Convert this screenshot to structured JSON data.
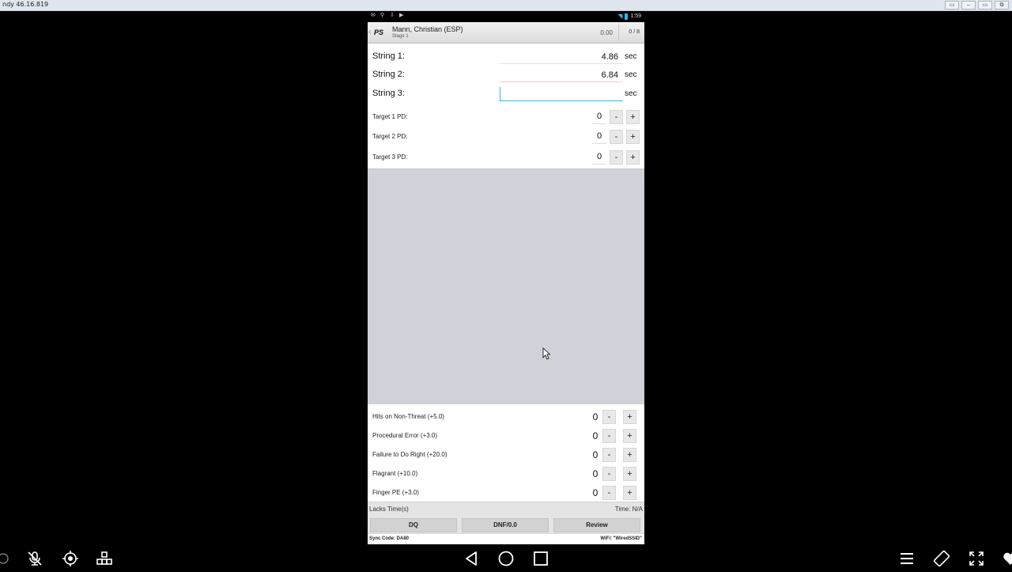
{
  "window": {
    "title": "ndy 46.16.819",
    "buttons": [
      "▭",
      "–",
      "▭",
      "⧉"
    ]
  },
  "statusbar": {
    "time": "1:59",
    "left_icons": [
      "mail-icon",
      "usb-icon",
      "download-icon",
      "play-icon"
    ]
  },
  "appbar": {
    "logo": "PS",
    "competitor": "Mann, Christian (ESP)",
    "stage": "Stage 1",
    "score": "0.00",
    "menu": "0 / 8"
  },
  "strings": [
    {
      "label": "String 1:",
      "value": "4.86",
      "unit": "sec"
    },
    {
      "label": "String 2:",
      "value": "6.84",
      "unit": "sec"
    },
    {
      "label": "String 3:",
      "value": "",
      "unit": "sec"
    }
  ],
  "targets": [
    {
      "label": "Target 1 PD:",
      "value": "0",
      "minus": "-",
      "plus": "+"
    },
    {
      "label": "Target 2 PD:",
      "value": "0",
      "minus": "-",
      "plus": "+"
    },
    {
      "label": "Target 3 PD:",
      "value": "0",
      "minus": "-",
      "plus": "+"
    }
  ],
  "penalties": [
    {
      "label": "Hits on Non-Threat (+5.0)",
      "value": "0",
      "minus": "-",
      "plus": "+"
    },
    {
      "label": "Procedural Error (+3.0)",
      "value": "0",
      "minus": "-",
      "plus": "+"
    },
    {
      "label": "Failure to Do Right (+20.0)",
      "value": "0",
      "minus": "-",
      "plus": "+"
    },
    {
      "label": "Flagrant (+10.0)",
      "value": "0",
      "minus": "-",
      "plus": "+"
    },
    {
      "label": "Finger PE (+3.0)",
      "value": "0",
      "minus": "-",
      "plus": "+"
    }
  ],
  "footer": {
    "lacks_time": "Lacks Time(s)",
    "time": "Time: N/A",
    "dq": "DQ",
    "dnf": "DNF/0.0",
    "review": "Review",
    "sync_code": "Sync Code: DA80",
    "wifi": "WiFi: \"WiredSSID\""
  },
  "colors": {
    "accent": "#33b5e5",
    "gray_area": "#cfd2d9"
  }
}
